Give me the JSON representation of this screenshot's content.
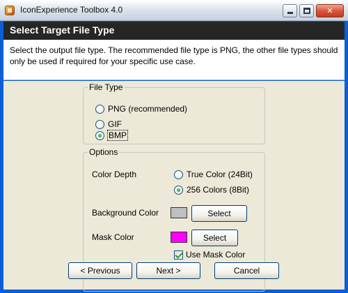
{
  "window": {
    "title": "IconExperience Toolbox 4.0"
  },
  "header": {
    "title": "Select Target File Type"
  },
  "description": "Select the output file type. The recommended file type is PNG, the other file types should only be used if required for your specific use case.",
  "file_type": {
    "legend": "File Type",
    "options": [
      {
        "label": "PNG (recommended)",
        "selected": false
      },
      {
        "label": "GIF",
        "selected": false
      },
      {
        "label": "BMP",
        "selected": true
      }
    ]
  },
  "options": {
    "legend": "Options",
    "color_depth": {
      "label": "Color Depth",
      "choices": [
        {
          "label": "True Color (24Bit)",
          "selected": false
        },
        {
          "label": "256 Colors (8Bit)",
          "selected": true
        }
      ]
    },
    "background_color": {
      "label": "Background Color",
      "swatch": "#c0c0c0",
      "button": "Select"
    },
    "mask_color": {
      "label": "Mask Color",
      "swatch": "#ff00ff",
      "button": "Select",
      "use_mask_label": "Use Mask Color",
      "use_mask_checked": true
    }
  },
  "buttons": {
    "previous": "< Previous",
    "next": "Next >",
    "cancel": "Cancel"
  }
}
